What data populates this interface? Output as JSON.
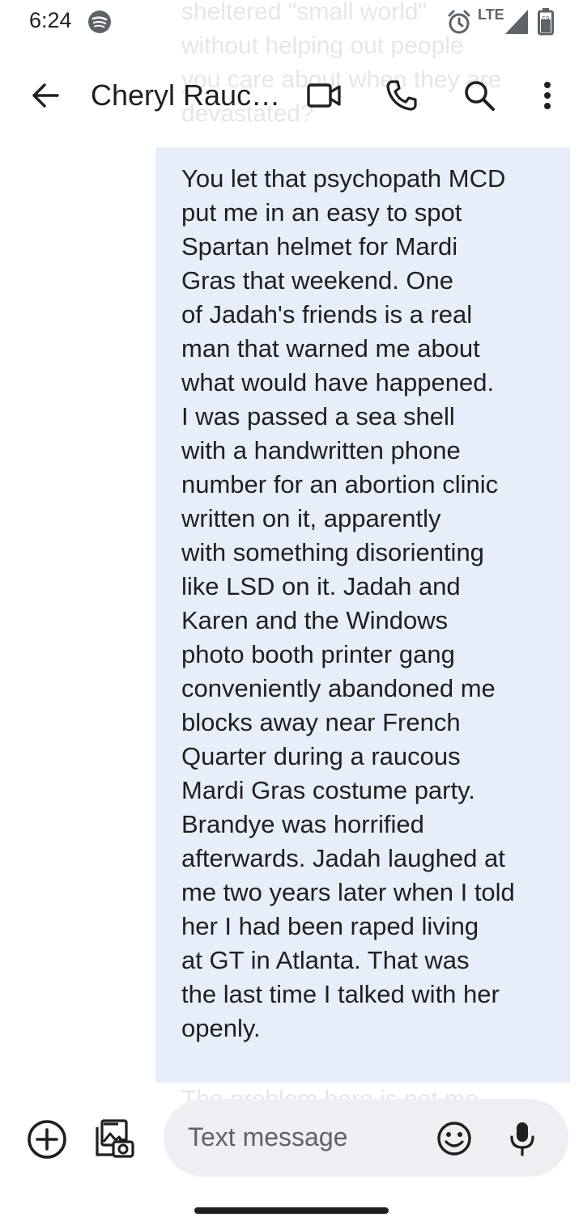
{
  "status_bar": {
    "time": "6:24",
    "network": "LTE",
    "battery": "59",
    "icons": [
      "spotify-icon",
      "alarm-icon",
      "signal-icon",
      "battery-icon"
    ]
  },
  "app_bar": {
    "title": "Cheryl Rauc…",
    "icons": [
      "back-arrow-icon",
      "video-call-icon",
      "phone-icon",
      "search-icon",
      "more-vert-icon"
    ]
  },
  "conversation": {
    "previous_message_partial": "sheltered \"small world\"\nwithout helping out people\nyou care about when they are\ndevastated?",
    "message": "You let that psychopath MCD\nput me in an easy to spot\nSpartan helmet for Mardi\nGras that weekend. One\nof Jadah's friends is a real\nman that warned me about\nwhat would have happened.\nI was passed a sea shell\nwith a handwritten phone\nnumber for an abortion clinic\nwritten on it, apparently\nwith something disorienting\nlike LSD on it. Jadah and\nKaren and the Windows\nphoto booth printer gang\nconveniently abandoned me\nblocks away near French\nQuarter during a raucous\nMardi Gras costume party.\nBrandye was horrified\nafterwards. Jadah laughed at\nme two years later when I told\nher I had been raped living\nat GT in Atlanta. That was\nthe last time I talked with her\nopenly.",
    "next_message_partial": "The problem here is not me"
  },
  "composer": {
    "placeholder": "Text message",
    "icons": [
      "add-circle-icon",
      "gallery-icon",
      "emoji-icon",
      "mic-icon"
    ]
  },
  "colors": {
    "bubble": "#e8eef9",
    "text": "#1f1f1f",
    "composer_bg": "#eeeff2"
  }
}
